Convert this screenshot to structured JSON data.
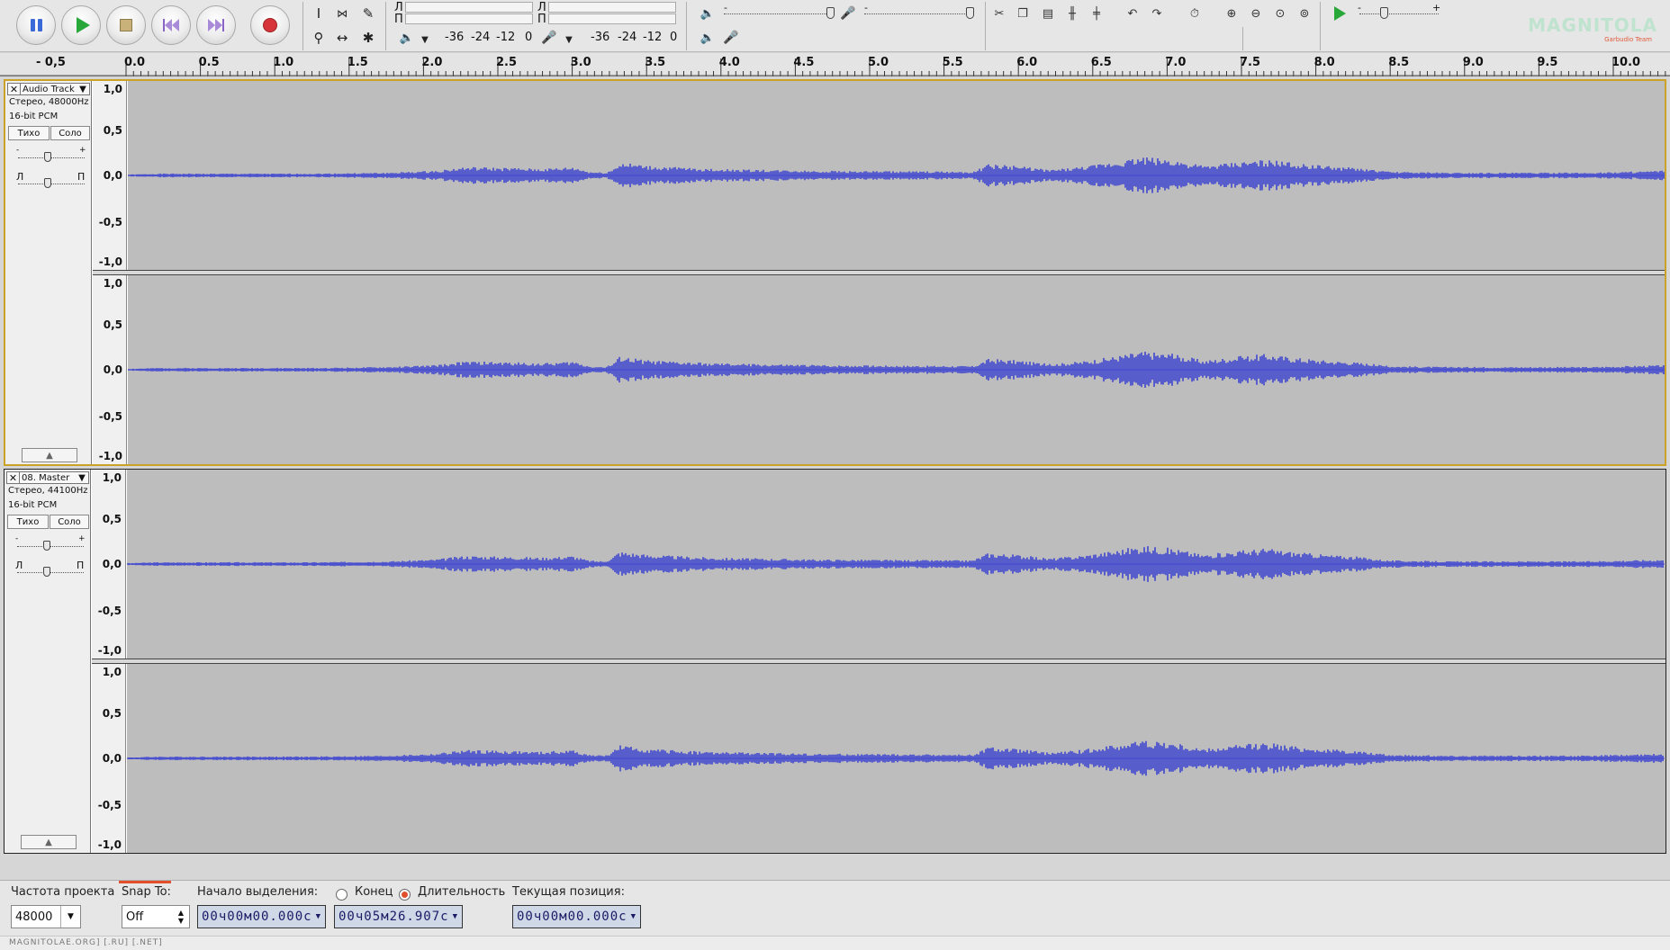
{
  "colors": {
    "waveform": "#3f45d0",
    "track_bg": "#bdbdbd",
    "selected_border": "#c9a227",
    "record": "#d6343a",
    "play": "#29a83a",
    "time_text": "#1a1a66"
  },
  "transport": {
    "pause_icon": "pause-icon",
    "play_icon": "play-icon",
    "stop_icon": "stop-icon",
    "skip_start_icon": "skip-start-icon",
    "skip_end_icon": "skip-end-icon",
    "record_icon": "record-icon"
  },
  "meters": {
    "left_ch": "Л",
    "right_ch": "П",
    "scale_play": [
      "-36",
      "-24",
      "-12",
      "0"
    ],
    "scale_rec": [
      "-36",
      "-24",
      "-12",
      "0"
    ]
  },
  "mixer": {
    "minus": "-",
    "plus": "+"
  },
  "ruler": {
    "labels": [
      "- 0,5",
      "0.0",
      "0.5",
      "1.0",
      "1.5",
      "2.0",
      "2.5",
      "3.0",
      "3.5",
      "4.0",
      "4.5",
      "5.0",
      "5.5",
      "6.0",
      "6.5",
      "7.0",
      "7.5",
      "8.0",
      "8.5",
      "9.0",
      "9.5",
      "10.0"
    ]
  },
  "tracks": [
    {
      "name": "Audio Track",
      "rate": "Стерео, 48000Hz",
      "format": "16-bit PCM",
      "mute": "Тихо",
      "solo": "Соло",
      "gain_minus": "-",
      "gain_plus": "+",
      "pan_left": "Л",
      "pan_right": "П",
      "vscale": [
        "1,0",
        "0,5",
        "0,0",
        "-0,5",
        "-1,0"
      ]
    },
    {
      "name": "08. Master",
      "rate": "Стерео, 44100Hz",
      "format": "16-bit PCM",
      "mute": "Тихо",
      "solo": "Соло",
      "gain_minus": "-",
      "gain_plus": "+",
      "pan_left": "Л",
      "pan_right": "П",
      "vscale": [
        "1,0",
        "0,5",
        "0,0",
        "-0,5",
        "-1,0"
      ]
    }
  ],
  "selection": {
    "rate_label": "Частота проекта",
    "rate_value": "48000",
    "snap_label": "Snap To:",
    "snap_value": "Off",
    "start_label": "Начало выделения:",
    "end_label": "Конец",
    "length_label": "Длительность",
    "position_label": "Текущая позиция:",
    "start_value": "00ч00м00.000с",
    "length_value": "00ч05м26.907с",
    "position_value": "00ч00м00.000с"
  },
  "status": "MAGNITOLAE.ORG] [.RU] [.NET]",
  "watermark": "MAGNITOLA",
  "watermark_sub": "Garbudio Team"
}
